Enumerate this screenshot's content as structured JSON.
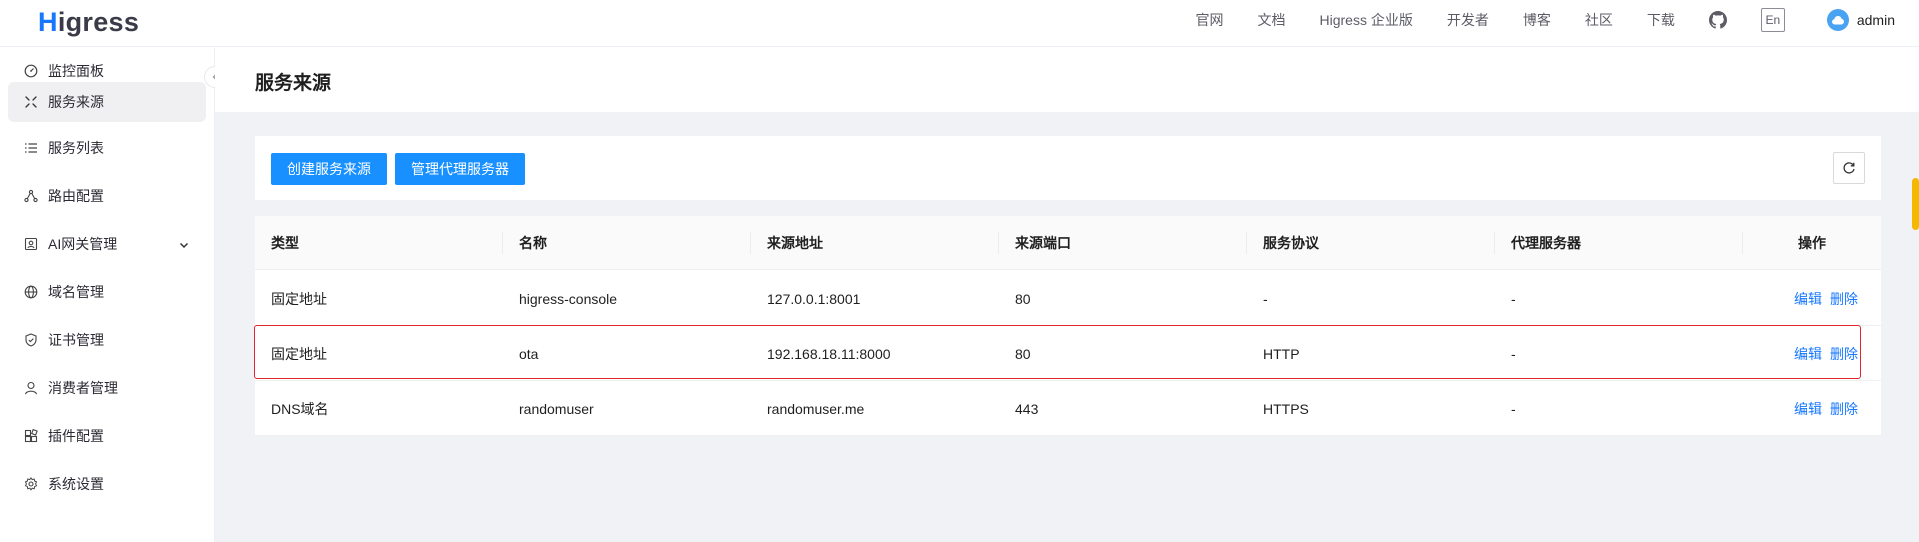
{
  "header": {
    "logo_h": "H",
    "logo_rest": "igress",
    "nav": [
      "官网",
      "文档",
      "Higress 企业版",
      "开发者",
      "博客",
      "社区",
      "下载"
    ],
    "lang": "En",
    "user": "admin"
  },
  "sidebar": {
    "items": [
      {
        "label": "监控面板",
        "icon": "dashboard-icon"
      },
      {
        "label": "服务来源",
        "icon": "service-source-icon"
      },
      {
        "label": "服务列表",
        "icon": "list-icon"
      },
      {
        "label": "路由配置",
        "icon": "route-icon"
      },
      {
        "label": "AI网关管理",
        "icon": "ai-gateway-icon"
      },
      {
        "label": "域名管理",
        "icon": "globe-icon"
      },
      {
        "label": "证书管理",
        "icon": "shield-icon"
      },
      {
        "label": "消费者管理",
        "icon": "user-icon"
      },
      {
        "label": "插件配置",
        "icon": "plugin-icon"
      },
      {
        "label": "系统设置",
        "icon": "gear-icon"
      }
    ],
    "active_index": 1
  },
  "main": {
    "title": "服务来源",
    "toolbar": {
      "create_label": "创建服务来源",
      "proxy_label": "管理代理服务器"
    },
    "table": {
      "columns": [
        "类型",
        "名称",
        "来源地址",
        "来源端口",
        "服务协议",
        "代理服务器",
        "操作"
      ],
      "rows": [
        {
          "type": "固定地址",
          "name": "higress-console",
          "address": "127.0.0.1:8001",
          "port": "80",
          "protocol": "-",
          "proxy": "-"
        },
        {
          "type": "固定地址",
          "name": "ota",
          "address": "192.168.18.11:8000",
          "port": "80",
          "protocol": "HTTP",
          "proxy": "-"
        },
        {
          "type": "DNS域名",
          "name": "randomuser",
          "address": "randomuser.me",
          "port": "443",
          "protocol": "HTTPS",
          "proxy": "-"
        }
      ],
      "edit_label": "编辑",
      "delete_label": "删除"
    }
  },
  "colors": {
    "primary": "#1890ff",
    "link": "#1677ff",
    "highlight": "#e0262e",
    "background": "#f0f2f5"
  }
}
